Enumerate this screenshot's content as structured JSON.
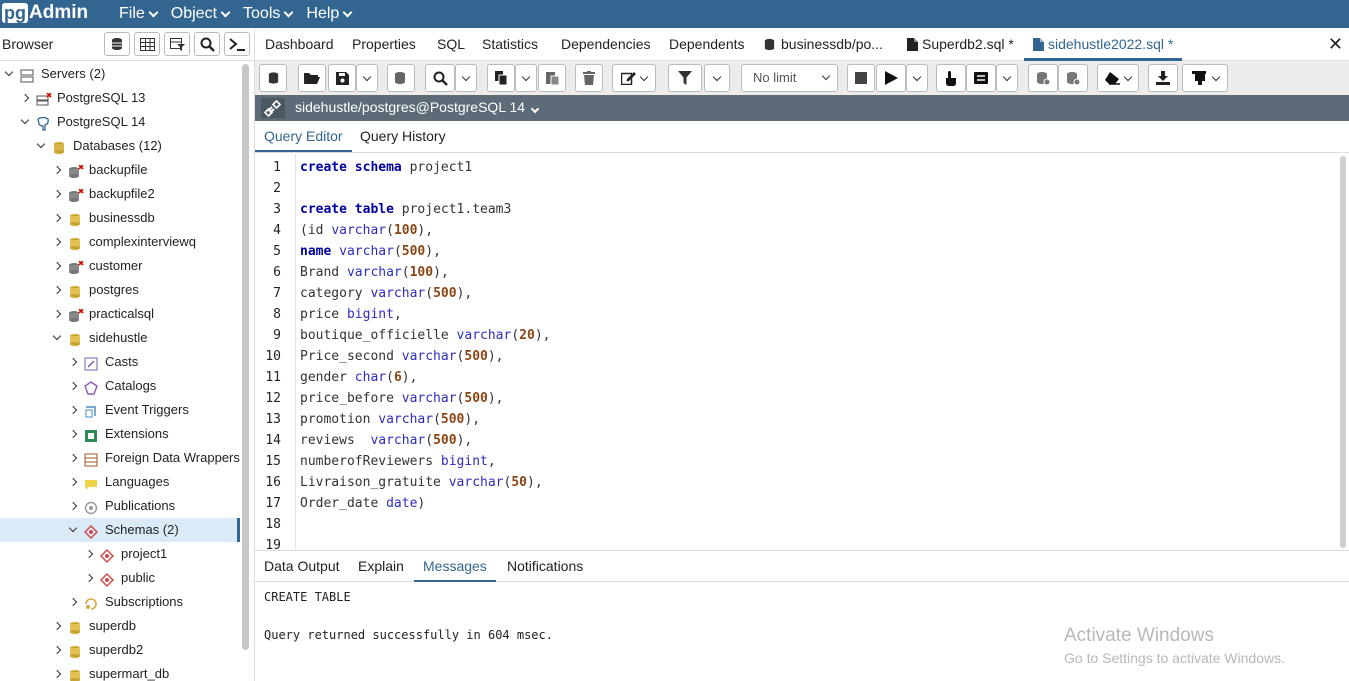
{
  "app": {
    "logo_pg": "pg",
    "logo_admin": "Admin"
  },
  "menu": [
    "File",
    "Object",
    "Tools",
    "Help"
  ],
  "browser": {
    "title": "Browser"
  },
  "tree": [
    {
      "label": "Servers (2)",
      "icon": "servers-icon",
      "level": 0,
      "state": "open"
    },
    {
      "label": "PostgreSQL 13",
      "icon": "server-disconnected-icon",
      "level": 1,
      "state": "closed"
    },
    {
      "label": "PostgreSQL 14",
      "icon": "elephant-icon",
      "level": 1,
      "state": "open"
    },
    {
      "label": "Databases (12)",
      "icon": "databases-icon",
      "level": 2,
      "state": "open"
    },
    {
      "label": "backupfile",
      "icon": "database-disconnected-icon",
      "level": 3,
      "state": "closed"
    },
    {
      "label": "backupfile2",
      "icon": "database-disconnected-icon",
      "level": 3,
      "state": "closed"
    },
    {
      "label": "businessdb",
      "icon": "database-icon",
      "level": 3,
      "state": "closed"
    },
    {
      "label": "complexinterviewq",
      "icon": "database-icon",
      "level": 3,
      "state": "closed"
    },
    {
      "label": "customer",
      "icon": "database-disconnected-icon",
      "level": 3,
      "state": "closed"
    },
    {
      "label": "postgres",
      "icon": "database-icon",
      "level": 3,
      "state": "closed"
    },
    {
      "label": "practicalsql",
      "icon": "database-disconnected-icon",
      "level": 3,
      "state": "closed"
    },
    {
      "label": "sidehustle",
      "icon": "database-icon",
      "level": 3,
      "state": "open"
    },
    {
      "label": "Casts",
      "icon": "casts-icon",
      "level": 4,
      "state": "closed"
    },
    {
      "label": "Catalogs",
      "icon": "catalogs-icon",
      "level": 4,
      "state": "closed"
    },
    {
      "label": "Event Triggers",
      "icon": "event-triggers-icon",
      "level": 4,
      "state": "closed"
    },
    {
      "label": "Extensions",
      "icon": "extensions-icon",
      "level": 4,
      "state": "closed"
    },
    {
      "label": "Foreign Data Wrappers",
      "icon": "foreign-data-wrappers-icon",
      "level": 4,
      "state": "closed"
    },
    {
      "label": "Languages",
      "icon": "languages-icon",
      "level": 4,
      "state": "closed"
    },
    {
      "label": "Publications",
      "icon": "publications-icon",
      "level": 4,
      "state": "closed"
    },
    {
      "label": "Schemas (2)",
      "icon": "schemas-icon",
      "level": 4,
      "state": "open",
      "selected": true
    },
    {
      "label": "project1",
      "icon": "schema-icon",
      "level": 5,
      "state": "closed"
    },
    {
      "label": "public",
      "icon": "schema-icon",
      "level": 5,
      "state": "closed"
    },
    {
      "label": "Subscriptions",
      "icon": "subscriptions-icon",
      "level": 4,
      "state": "closed"
    },
    {
      "label": "superdb",
      "icon": "database-icon",
      "level": 3,
      "state": "closed"
    },
    {
      "label": "superdb2",
      "icon": "database-icon",
      "level": 3,
      "state": "closed"
    },
    {
      "label": "supermart_db",
      "icon": "database-icon",
      "level": 3,
      "state": "closed"
    }
  ],
  "tabs": {
    "dashboard": "Dashboard",
    "properties": "Properties",
    "sql": "SQL",
    "statistics": "Statistics",
    "dependencies": "Dependencies",
    "dependents": "Dependents",
    "businessdb": "businessdb/po...",
    "superdb2": "Superdb2.sql *",
    "sidehustle": "sidehustle2022.sql *"
  },
  "toolbar": {
    "limit": "No limit"
  },
  "connection": {
    "label": "sidehustle/postgres@PostgreSQL 14"
  },
  "editor_tabs": {
    "query_editor": "Query Editor",
    "query_history": "Query History"
  },
  "code_lines": [
    "create schema project1",
    "",
    "create table project1.team3",
    "(id varchar(100),",
    "name varchar(500),",
    "Brand varchar(100),",
    "category varchar(500),",
    "price bigint,",
    "boutique_officielle varchar(20),",
    "Price_second varchar(500),",
    "gender char(6),",
    "price_before varchar(500),",
    "promotion varchar(500),",
    "reviews  varchar(500),",
    "numberofReviewers bigint,",
    "Livraison_gratuite varchar(50),",
    "Order_date date)",
    "",
    ""
  ],
  "output_tabs": {
    "data_output": "Data Output",
    "explain": "Explain",
    "messages": "Messages",
    "notifications": "Notifications"
  },
  "messages": {
    "line1": "CREATE TABLE",
    "line2": "Query returned successfully in 604 msec."
  },
  "watermark": {
    "title": "Activate Windows",
    "subtitle": "Go to Settings to activate Windows."
  },
  "colors": {
    "brand": "#326690",
    "connbar": "#5c6b77"
  }
}
